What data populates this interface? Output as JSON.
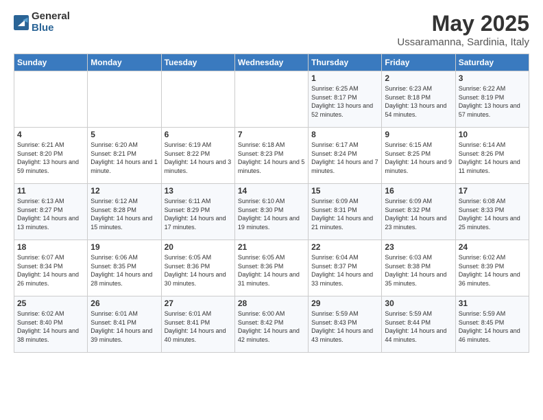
{
  "logo": {
    "general": "General",
    "blue": "Blue"
  },
  "title": "May 2025",
  "subtitle": "Ussaramanna, Sardinia, Italy",
  "weekdays": [
    "Sunday",
    "Monday",
    "Tuesday",
    "Wednesday",
    "Thursday",
    "Friday",
    "Saturday"
  ],
  "weeks": [
    [
      {
        "day": "",
        "sunrise": "",
        "sunset": "",
        "daylight": ""
      },
      {
        "day": "",
        "sunrise": "",
        "sunset": "",
        "daylight": ""
      },
      {
        "day": "",
        "sunrise": "",
        "sunset": "",
        "daylight": ""
      },
      {
        "day": "",
        "sunrise": "",
        "sunset": "",
        "daylight": ""
      },
      {
        "day": "1",
        "sunrise": "6:25 AM",
        "sunset": "8:17 PM",
        "daylight": "13 hours and 52 minutes."
      },
      {
        "day": "2",
        "sunrise": "6:23 AM",
        "sunset": "8:18 PM",
        "daylight": "13 hours and 54 minutes."
      },
      {
        "day": "3",
        "sunrise": "6:22 AM",
        "sunset": "8:19 PM",
        "daylight": "13 hours and 57 minutes."
      }
    ],
    [
      {
        "day": "4",
        "sunrise": "6:21 AM",
        "sunset": "8:20 PM",
        "daylight": "13 hours and 59 minutes."
      },
      {
        "day": "5",
        "sunrise": "6:20 AM",
        "sunset": "8:21 PM",
        "daylight": "14 hours and 1 minute."
      },
      {
        "day": "6",
        "sunrise": "6:19 AM",
        "sunset": "8:22 PM",
        "daylight": "14 hours and 3 minutes."
      },
      {
        "day": "7",
        "sunrise": "6:18 AM",
        "sunset": "8:23 PM",
        "daylight": "14 hours and 5 minutes."
      },
      {
        "day": "8",
        "sunrise": "6:17 AM",
        "sunset": "8:24 PM",
        "daylight": "14 hours and 7 minutes."
      },
      {
        "day": "9",
        "sunrise": "6:15 AM",
        "sunset": "8:25 PM",
        "daylight": "14 hours and 9 minutes."
      },
      {
        "day": "10",
        "sunrise": "6:14 AM",
        "sunset": "8:26 PM",
        "daylight": "14 hours and 11 minutes."
      }
    ],
    [
      {
        "day": "11",
        "sunrise": "6:13 AM",
        "sunset": "8:27 PM",
        "daylight": "14 hours and 13 minutes."
      },
      {
        "day": "12",
        "sunrise": "6:12 AM",
        "sunset": "8:28 PM",
        "daylight": "14 hours and 15 minutes."
      },
      {
        "day": "13",
        "sunrise": "6:11 AM",
        "sunset": "8:29 PM",
        "daylight": "14 hours and 17 minutes."
      },
      {
        "day": "14",
        "sunrise": "6:10 AM",
        "sunset": "8:30 PM",
        "daylight": "14 hours and 19 minutes."
      },
      {
        "day": "15",
        "sunrise": "6:09 AM",
        "sunset": "8:31 PM",
        "daylight": "14 hours and 21 minutes."
      },
      {
        "day": "16",
        "sunrise": "6:09 AM",
        "sunset": "8:32 PM",
        "daylight": "14 hours and 23 minutes."
      },
      {
        "day": "17",
        "sunrise": "6:08 AM",
        "sunset": "8:33 PM",
        "daylight": "14 hours and 25 minutes."
      }
    ],
    [
      {
        "day": "18",
        "sunrise": "6:07 AM",
        "sunset": "8:34 PM",
        "daylight": "14 hours and 26 minutes."
      },
      {
        "day": "19",
        "sunrise": "6:06 AM",
        "sunset": "8:35 PM",
        "daylight": "14 hours and 28 minutes."
      },
      {
        "day": "20",
        "sunrise": "6:05 AM",
        "sunset": "8:36 PM",
        "daylight": "14 hours and 30 minutes."
      },
      {
        "day": "21",
        "sunrise": "6:05 AM",
        "sunset": "8:36 PM",
        "daylight": "14 hours and 31 minutes."
      },
      {
        "day": "22",
        "sunrise": "6:04 AM",
        "sunset": "8:37 PM",
        "daylight": "14 hours and 33 minutes."
      },
      {
        "day": "23",
        "sunrise": "6:03 AM",
        "sunset": "8:38 PM",
        "daylight": "14 hours and 35 minutes."
      },
      {
        "day": "24",
        "sunrise": "6:02 AM",
        "sunset": "8:39 PM",
        "daylight": "14 hours and 36 minutes."
      }
    ],
    [
      {
        "day": "25",
        "sunrise": "6:02 AM",
        "sunset": "8:40 PM",
        "daylight": "14 hours and 38 minutes."
      },
      {
        "day": "26",
        "sunrise": "6:01 AM",
        "sunset": "8:41 PM",
        "daylight": "14 hours and 39 minutes."
      },
      {
        "day": "27",
        "sunrise": "6:01 AM",
        "sunset": "8:41 PM",
        "daylight": "14 hours and 40 minutes."
      },
      {
        "day": "28",
        "sunrise": "6:00 AM",
        "sunset": "8:42 PM",
        "daylight": "14 hours and 42 minutes."
      },
      {
        "day": "29",
        "sunrise": "5:59 AM",
        "sunset": "8:43 PM",
        "daylight": "14 hours and 43 minutes."
      },
      {
        "day": "30",
        "sunrise": "5:59 AM",
        "sunset": "8:44 PM",
        "daylight": "14 hours and 44 minutes."
      },
      {
        "day": "31",
        "sunrise": "5:59 AM",
        "sunset": "8:45 PM",
        "daylight": "14 hours and 46 minutes."
      }
    ]
  ]
}
